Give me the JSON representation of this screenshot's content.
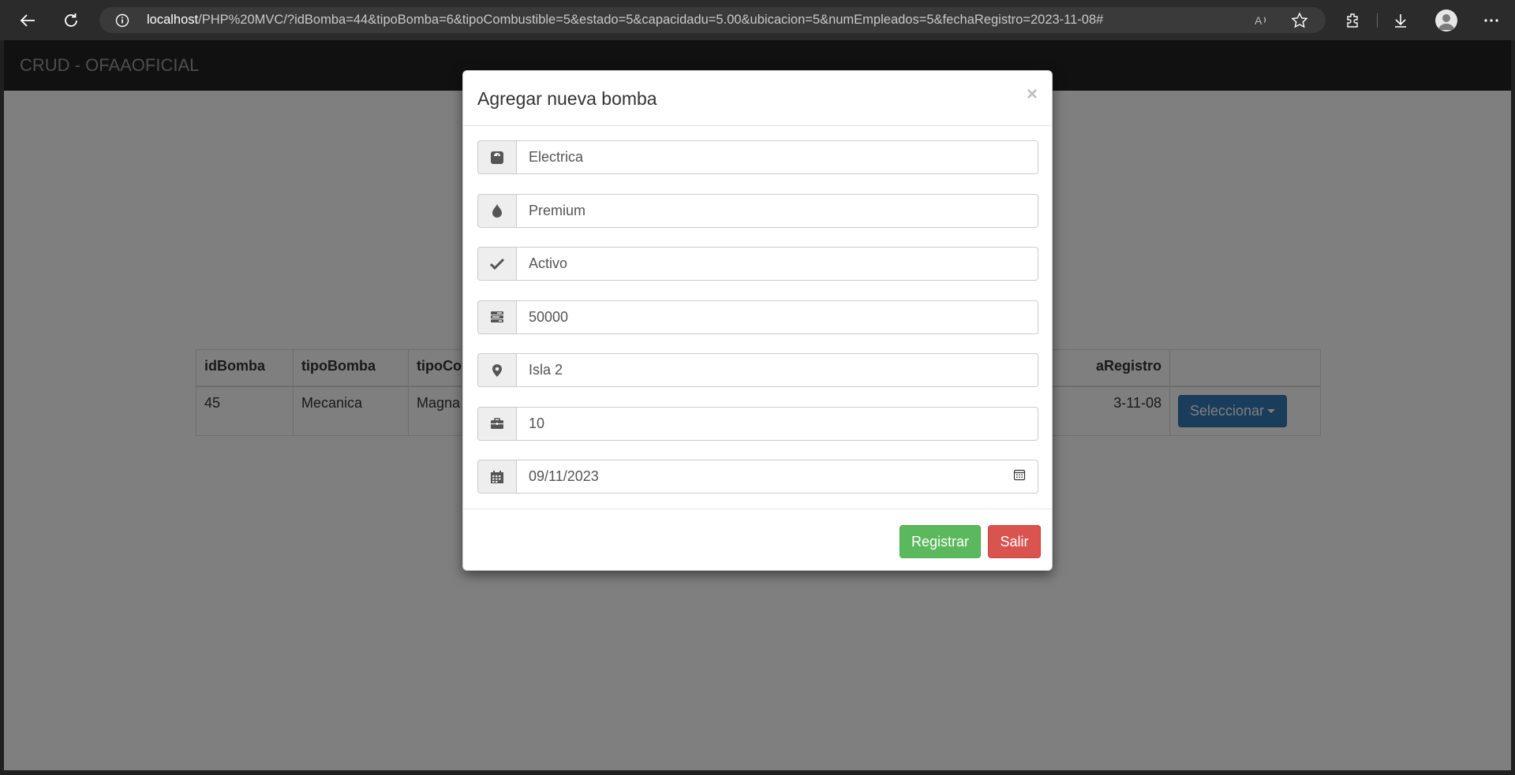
{
  "browser": {
    "url_host": "localhost",
    "url_path": "/PHP%20MVC/?idBomba=44&tipoBomba=6&tipoCombustible=5&estado=5&capacidadu=5.00&ubicacion=5&numEmpleados=5&fechaRegistro=2023-11-08#"
  },
  "navbar": {
    "brand": "CRUD - OFAAOFICIAL"
  },
  "table": {
    "headers": [
      "idBomba",
      "tipoBomba",
      "tipoCom",
      "aRegistro",
      ""
    ],
    "row": [
      "45",
      "Mecanica",
      "Magna",
      "3-11-08"
    ],
    "select_label": "Seleccionar"
  },
  "modal": {
    "title": "Agregar nueva bomba",
    "close": "×",
    "fields": [
      {
        "icon": "scale-icon",
        "value": "Electrica"
      },
      {
        "icon": "tint-icon",
        "value": "Premium"
      },
      {
        "icon": "check-icon",
        "value": "Activo"
      },
      {
        "icon": "tasks-icon",
        "value": "50000"
      },
      {
        "icon": "map-marker-icon",
        "value": "Isla 2"
      },
      {
        "icon": "briefcase-icon",
        "value": "10"
      },
      {
        "icon": "calendar-icon",
        "value": "09/11/2023"
      }
    ],
    "register_label": "Registrar",
    "exit_label": "Salir"
  },
  "colors": {
    "success": "#5cb85c",
    "danger": "#d9534f",
    "primary": "#337ab7",
    "navbar": "#222222"
  }
}
